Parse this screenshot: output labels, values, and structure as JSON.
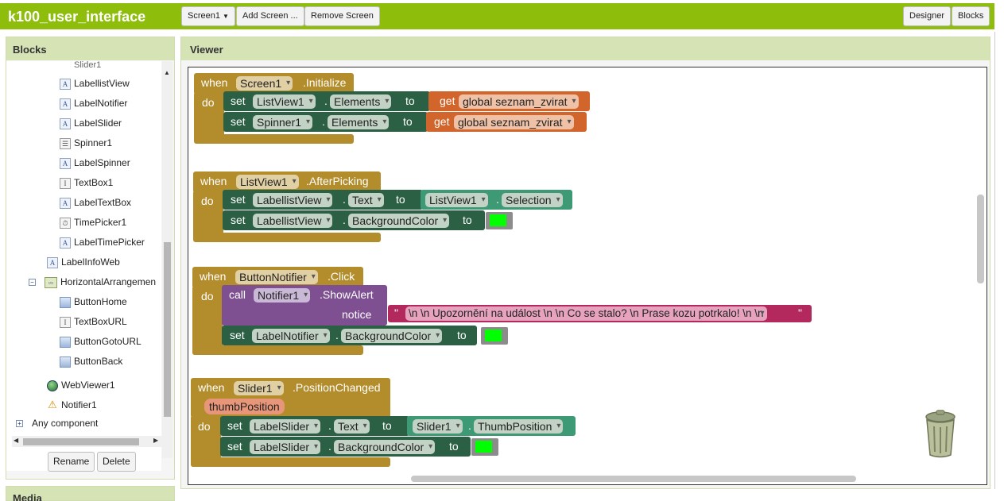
{
  "app": {
    "title": "k100_user_interface"
  },
  "toolbar": {
    "screen_dropdown": "Screen1",
    "add_screen": "Add Screen ...",
    "remove_screen": "Remove Screen",
    "designer": "Designer",
    "blocks": "Blocks"
  },
  "blocks_panel": {
    "title": "Blocks",
    "items": [
      {
        "label": "Slider1",
        "icon": "slider-icon"
      },
      {
        "label": "LabellistView",
        "icon": "label-icon"
      },
      {
        "label": "LabelNotifier",
        "icon": "label-icon"
      },
      {
        "label": "LabelSlider",
        "icon": "label-icon"
      },
      {
        "label": "Spinner1",
        "icon": "spinner-icon"
      },
      {
        "label": "LabelSpinner",
        "icon": "label-icon"
      },
      {
        "label": "TextBox1",
        "icon": "textbox-icon"
      },
      {
        "label": "LabelTextBox",
        "icon": "label-icon"
      },
      {
        "label": "TimePicker1",
        "icon": "timepicker-icon"
      },
      {
        "label": "LabelTimePicker",
        "icon": "label-icon"
      },
      {
        "label": "LabelInfoWeb",
        "icon": "label-icon"
      },
      {
        "label": "HorizontalArrangemen",
        "icon": "arrangement-icon"
      },
      {
        "label": "ButtonHome",
        "icon": "button-icon"
      },
      {
        "label": "TextBoxURL",
        "icon": "textbox-icon"
      },
      {
        "label": "ButtonGotoURL",
        "icon": "button-icon"
      },
      {
        "label": "ButtonBack",
        "icon": "button-icon"
      },
      {
        "label": "WebViewer1",
        "icon": "webviewer-icon"
      },
      {
        "label": "Notifier1",
        "icon": "notifier-icon"
      },
      {
        "label": "Any component",
        "icon": "expand-icon"
      }
    ],
    "rename": "Rename",
    "delete": "Delete"
  },
  "media_panel": {
    "title": "Media"
  },
  "viewer": {
    "title": "Viewer",
    "kw": {
      "when": "when",
      "do": "do",
      "set": "set",
      "to": "to",
      "get": "get",
      "call": "call",
      "dot": ".",
      "notice": "notice",
      "quote": "\""
    },
    "ev1": {
      "component": "Screen1",
      "event": ".Initialize",
      "s1_comp": "ListView1",
      "s1_prop": "Elements",
      "s1_var": "global seznam_zvirat",
      "s2_comp": "Spinner1",
      "s2_prop": "Elements",
      "s2_var": "global seznam_zvirat"
    },
    "ev2": {
      "component": "ListView1",
      "event": ".AfterPicking",
      "s1_comp": "LabellistView",
      "s1_prop": "Text",
      "s1_src_comp": "ListView1",
      "s1_src_prop": "Selection",
      "s2_comp": "LabellistView",
      "s2_prop": "BackgroundColor"
    },
    "ev3": {
      "component": "ButtonNotifier",
      "event": ".Click",
      "call_comp": "Notifier1",
      "call_method": ".ShowAlert",
      "notice_text": "\\n \\n Upozornění na událost \\n \\n Co se stalo? \\n Prase kozu potrkalo! \\n \\n",
      "s1_comp": "LabelNotifier",
      "s1_prop": "BackgroundColor"
    },
    "ev4": {
      "component": "Slider1",
      "event": ".PositionChanged",
      "param": "thumbPosition",
      "s1_comp": "LabelSlider",
      "s1_prop": "Text",
      "s1_src_comp": "Slider1",
      "s1_src_prop": "ThumbPosition",
      "s2_comp": "LabelSlider",
      "s2_prop": "BackgroundColor"
    },
    "color_value": "#00ff00"
  },
  "colors": {
    "brand_green": "#8ebd0c",
    "panel_header": "#d5e3b5",
    "event_block": "#b38c2b",
    "setter_block": "#2b6044",
    "getter_block": "#d2652c",
    "component_block": "#3d9a74",
    "call_block": "#7e4f91",
    "text_block": "#b3295e"
  }
}
